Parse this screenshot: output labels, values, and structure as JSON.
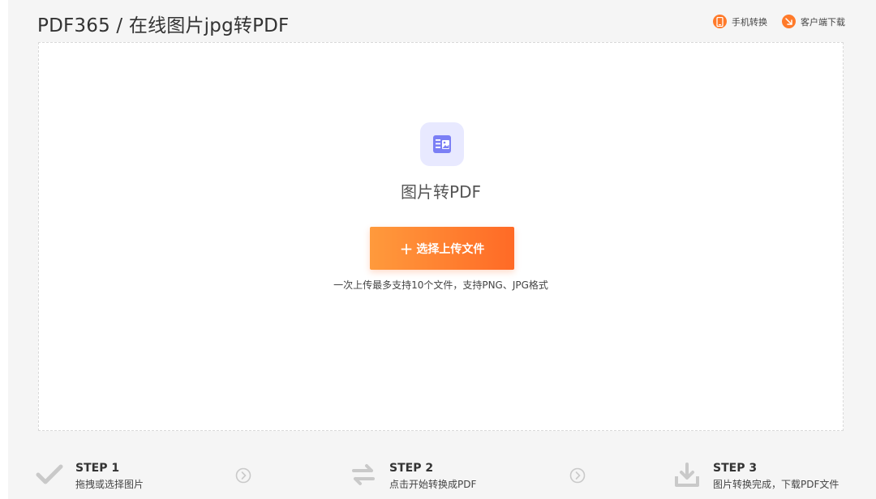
{
  "header": {
    "title": "PDF365 / 在线图片jpg转PDF",
    "links": [
      {
        "label": "手机转换",
        "icon": "phone-icon"
      },
      {
        "label": "客户端下载",
        "icon": "download-client-icon"
      }
    ]
  },
  "upload": {
    "icon": "image-document-icon",
    "title": "图片转PDF",
    "button_label": "选择上传文件",
    "hint": "一次上传最多支持10个文件，支持PNG、JPG格式"
  },
  "steps": [
    {
      "label": "STEP 1",
      "desc": "拖拽或选择图片",
      "icon": "check-icon"
    },
    {
      "label": "STEP 2",
      "desc": "点击开始转换成PDF",
      "icon": "swap-arrows-icon"
    },
    {
      "label": "STEP 3",
      "desc": "图片转换完成，下载PDF文件",
      "icon": "download-tray-icon"
    }
  ],
  "colors": {
    "accent": "#ff7a2a",
    "icon_bg": "#e8e9ff",
    "icon_fg": "#7b7ff5"
  }
}
